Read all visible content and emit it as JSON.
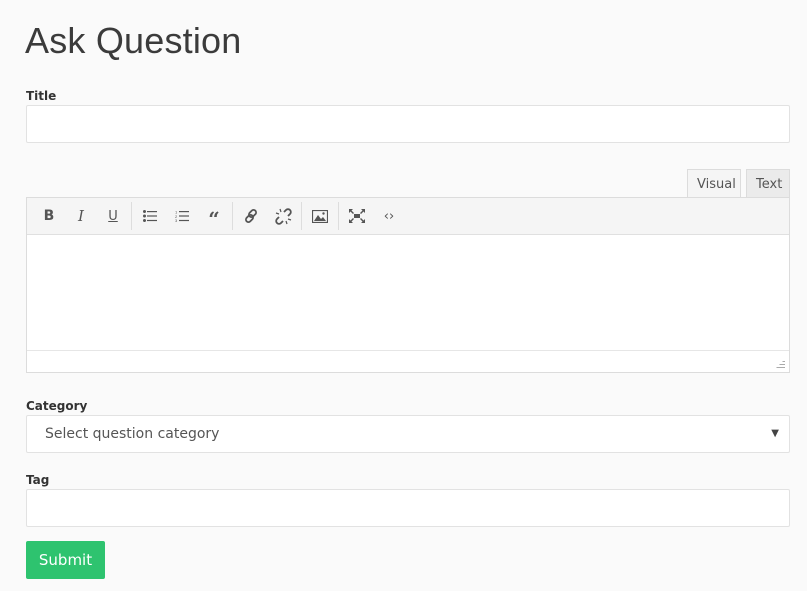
{
  "page": {
    "title": "Ask Question"
  },
  "form": {
    "title_label": "Title",
    "title_value": "",
    "editor": {
      "tabs": [
        {
          "label": "Visual",
          "active": true
        },
        {
          "label": "Text",
          "active": false
        }
      ],
      "toolbar": [
        "bold-icon",
        "italic-icon",
        "underline-icon",
        "bullet-list-icon",
        "numbered-list-icon",
        "blockquote-icon",
        "link-icon",
        "unlink-icon",
        "image-icon",
        "fullscreen-icon",
        "code-icon"
      ],
      "content": ""
    },
    "category_label": "Category",
    "category_selected": "Select question category",
    "tag_label": "Tag",
    "tag_value": "",
    "submit_label": "Submit"
  },
  "colors": {
    "submit": "#2ec36f"
  }
}
